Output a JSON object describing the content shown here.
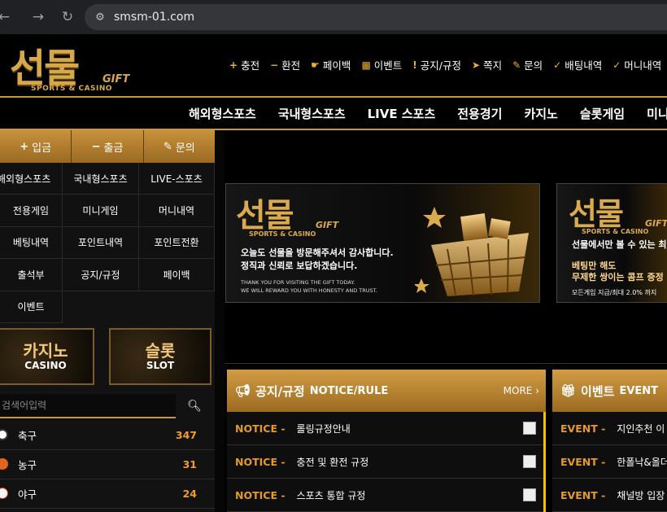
{
  "browser": {
    "url": "smsm-01.com",
    "back_icon": "arrow-left-icon",
    "forward_icon": "arrow-right-icon",
    "reload_icon": "reload-icon"
  },
  "logo": {
    "main": "선물",
    "gift": "GIFT",
    "sub": "SPORTS & CASINO"
  },
  "topmenu": [
    {
      "icon": "+",
      "label": "충전"
    },
    {
      "icon": "−",
      "label": "환전"
    },
    {
      "icon": "☛",
      "label": "페이백"
    },
    {
      "icon": "▦",
      "label": "이벤트"
    },
    {
      "icon": "!",
      "label": "공지/규정"
    },
    {
      "icon": "➤",
      "label": "쪽지"
    },
    {
      "icon": "✎",
      "label": "문의"
    },
    {
      "icon": "✓",
      "label": "배팅내역"
    },
    {
      "icon": "✓",
      "label": "머니내역"
    }
  ],
  "mainmenu": [
    "해외형스포츠",
    "국내형스포츠",
    "LIVE 스포츠",
    "전용경기",
    "카지노",
    "슬롯게임",
    "미니게임"
  ],
  "sidebar": {
    "quick": [
      {
        "icon": "+",
        "label": "입금"
      },
      {
        "icon": "−",
        "label": "출금"
      },
      {
        "icon": "✎",
        "label": "문의"
      }
    ],
    "grid": [
      "해외형스포츠",
      "국내형스포츠",
      "LIVE-스포츠",
      "전용게임",
      "미니게임",
      "머니내역",
      "베팅내역",
      "포인트내역",
      "포인트전환",
      "출석부",
      "공지/규정",
      "페이백",
      "이벤트"
    ],
    "casino": {
      "title": "카지노",
      "sub": "CASINO"
    },
    "slot": {
      "title": "슬롯",
      "sub": "SLOT"
    },
    "search_placeholder": "검색어입력",
    "sports": [
      {
        "name": "축구",
        "count": "347",
        "color": "#ffffff"
      },
      {
        "name": "농구",
        "count": "31",
        "color": "#e0661e"
      },
      {
        "name": "야구",
        "count": "24",
        "color": "#f4f4f4"
      }
    ]
  },
  "banner1": {
    "logo": "선물",
    "gift": "GIFT",
    "sub": "SPORTS & CASINO",
    "line1": "오늘도 선물을 방문해주셔서 감사합니다.",
    "line2": "정직과 신뢰로 보답하겠습니다.",
    "eng1": "THANK YOU FOR VISITING THE GIFT TODAY.",
    "eng2": "WE WILL REWARD YOU WITH HONESTY AND TRUST."
  },
  "banner2": {
    "logo": "선물",
    "gift": "GIFT",
    "sub": "SPORTS & CASINO",
    "line1": "선물에서만 볼 수 있는 최",
    "line2": "베팅만 해도",
    "line3": "무제한 쌍이는 콤프 증정",
    "line4": "모든게임 지급/최대 2.0% 까지"
  },
  "notice": {
    "title": "공지/규정",
    "title_en": "NOTICE/RULE",
    "more": "MORE ›",
    "tag": "NOTICE -",
    "items": [
      "롤링규정안내",
      "충전 및 환전 규정",
      "스포츠 통합 규정"
    ]
  },
  "event": {
    "title": "이벤트",
    "title_en": "EVENT",
    "tag": "EVENT -",
    "items": [
      "지인추천 이",
      "한폴낙&올더",
      "채널방 입장"
    ]
  }
}
